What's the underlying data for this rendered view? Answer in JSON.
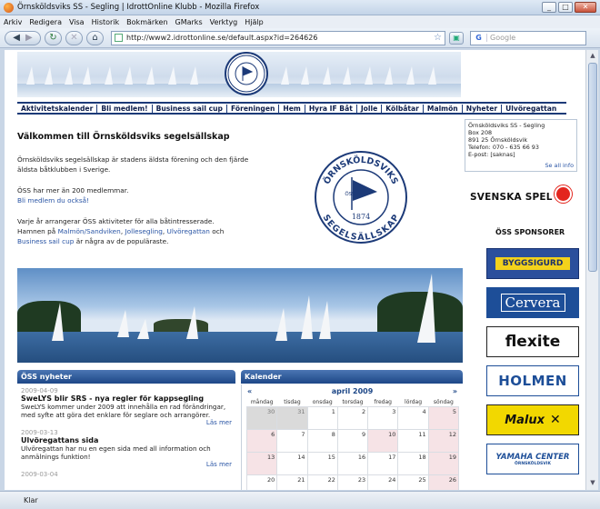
{
  "window": {
    "title": "Örnsköldsviks SS - Segling | IdrottOnline Klubb - Mozilla Firefox",
    "buttons": [
      "_",
      "□",
      "✕"
    ]
  },
  "menu": [
    "Arkiv",
    "Redigera",
    "Visa",
    "Historik",
    "Bokmärken",
    "GMarks",
    "Verktyg",
    "Hjälp"
  ],
  "toolbar": {
    "url": "http://www2.idrottonline.se/default.aspx?id=264626",
    "search_placeholder": "Google"
  },
  "site": {
    "nav": [
      "Aktivitetskalender",
      "Bli medlem!",
      "Business sail cup",
      "Föreningen",
      "Hem",
      "Hyra IF Båt",
      "Jolle",
      "Kölbåtar",
      "Malmön",
      "Nyheter",
      "Ulvöregattan"
    ],
    "logo_text_top": "ÖRNSKÖLDSVIKS",
    "logo_text_bottom": "SEGELSÄLLSKAP",
    "logo_year": "1874",
    "logo_letters": "ÖSS"
  },
  "welcome": {
    "heading": "Välkommen till Örnsköldsviks segelsällskap",
    "p1": "Örnsköldsviks segelsällskap är stadens äldsta förening och den fjärde äldsta båtklubben i Sverige.",
    "p2": "ÖSS har mer än 200 medlemmar.",
    "link_member": "Bli medlem du också!",
    "p3": "Varje år arrangerar ÖSS aktiviteter för alla båtintresserade.",
    "p4_prefix": "Hamnen på ",
    "link_malmon": "Malmön/Sandviken",
    "sep1": ", ",
    "link_jolle": "Jollesegling",
    "sep2": ", ",
    "link_ulvo": "Ulvöregattan",
    "p4_and": " och ",
    "link_bsc": "Business sail cup",
    "p4_suffix": " är några av de populäraste."
  },
  "contact": {
    "name": "Örnsköldsviks SS - Segling",
    "box": "Box 208",
    "city": "891 25 Örnsköldsvik",
    "phone": "Telefon: 070 - 635 66 93",
    "email": "E-post: [saknas]",
    "more": "Se all info"
  },
  "sponsors": {
    "svenska_spel": "SVENSKA SPEL",
    "heading": "ÖSS SPONSORER",
    "items": [
      "BYGGSIGURD",
      "Cervera",
      "flexite",
      "HOLMEN",
      "Malux",
      "YAMAHA CENTER"
    ],
    "yamaha_sub": "ÖRNSKÖLDSVIK"
  },
  "news": {
    "heading": "ÖSS nyheter",
    "items": [
      {
        "date": "2009-04-09",
        "title": "SweLYS blir SRS - nya regler för kappsegling",
        "text": "SweLYS kommer under 2009 att innehålla en rad förändringar, med syfte att göra det enklare för seglare och arrangörer.",
        "more": "Läs mer"
      },
      {
        "date": "2009-03-13",
        "title": "Ulvöregattans sida",
        "text": "Ulvöregattan har nu en egen sida med all information och anmälnings funktion!",
        "more": "Läs mer"
      },
      {
        "date": "2009-03-04",
        "title": "",
        "text": "",
        "more": ""
      }
    ]
  },
  "calendar": {
    "heading": "Kalender",
    "month": "april 2009",
    "prev": "«",
    "next": "»",
    "days": [
      "måndag",
      "tisdag",
      "onsdag",
      "torsdag",
      "fredag",
      "lördag",
      "söndag"
    ],
    "weeks": [
      [
        "30",
        "31",
        "1",
        "2",
        "3",
        "4",
        "5"
      ],
      [
        "6",
        "7",
        "8",
        "9",
        "10",
        "11",
        "12"
      ],
      [
        "13",
        "14",
        "15",
        "16",
        "17",
        "18",
        "19"
      ],
      [
        "20",
        "21",
        "22",
        "23",
        "24",
        "25",
        "26"
      ]
    ]
  },
  "status": {
    "text": "Klar"
  }
}
